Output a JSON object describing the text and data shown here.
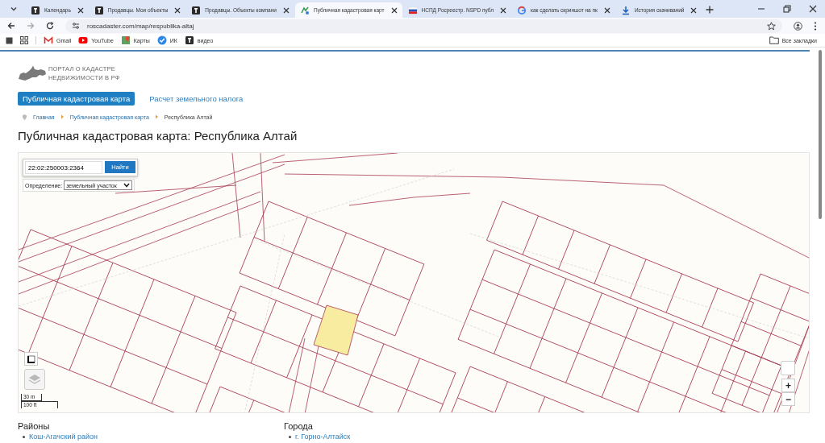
{
  "browser": {
    "tabs": [
      {
        "title": "Календарь",
        "kind": "square",
        "selected": false
      },
      {
        "title": "Продавцы. Мои объекты",
        "kind": "square",
        "selected": false
      },
      {
        "title": "Продавцы. Объекты компани",
        "kind": "square",
        "selected": false
      },
      {
        "title": "Публичная кадастровая карт",
        "kind": "map",
        "selected": true
      },
      {
        "title": "НСПД Росреестр. NSPD публ",
        "kind": "flag",
        "selected": false
      },
      {
        "title": "как сделать скриншот на пк",
        "kind": "google",
        "selected": false
      },
      {
        "title": "История скачиваний",
        "kind": "download",
        "selected": false
      }
    ],
    "address": "roscadaster.com/map/respublika-altaj",
    "bookmarks": [
      {
        "label": "Gmail",
        "kind": "mail"
      },
      {
        "label": "YouTube",
        "kind": "play"
      },
      {
        "label": "Карты",
        "kind": "pin"
      },
      {
        "label": "ИК",
        "kind": "check"
      },
      {
        "label": "видео",
        "kind": "square"
      }
    ],
    "all_bookmarks": "Все закладки"
  },
  "page": {
    "logo": [
      "ПОРТАЛ О КАДАСТРЕ",
      "НЕДВИЖИМОСТИ В РФ"
    ],
    "nav": [
      {
        "label": "Публичная кадастровая карта",
        "selected": true
      },
      {
        "label": "Расчет земельного налога",
        "selected": false
      }
    ],
    "breadcrumbs": [
      "Главная",
      "Публичная кадастровая карта",
      "Республика Алтай"
    ],
    "title": "Публичная кадастровая карта: Республика Алтай",
    "map": {
      "search_value": "22:02:250003:2364",
      "search_button": "Найти",
      "definition_label": "Определение:",
      "definition_value": "земельный участок",
      "zoom_in": "+",
      "zoom_out": "−",
      "scale": [
        "30 m",
        "100 ft"
      ]
    },
    "sections": [
      {
        "heading": "Районы",
        "items": [
          "Кош-Агачский район"
        ]
      },
      {
        "heading": "Города",
        "items": [
          "г. Горно-Алтайск"
        ]
      }
    ]
  }
}
